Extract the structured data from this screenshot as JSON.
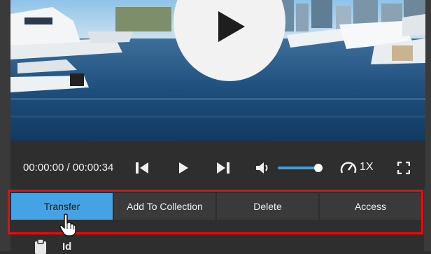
{
  "video": {
    "current_time": "00:00:00",
    "duration": "00:00:34",
    "time_display": "00:00:00 / 00:00:34",
    "playback_speed": "1X",
    "volume_fraction": 0.85
  },
  "actions": {
    "tabs": [
      {
        "label": "Transfer",
        "active": true
      },
      {
        "label": "Add To Collection",
        "active": false
      },
      {
        "label": "Delete",
        "active": false
      },
      {
        "label": "Access",
        "active": false
      }
    ]
  },
  "details": {
    "id_label": "Id"
  },
  "colors": {
    "accent": "#45a3e5",
    "highlight_border": "#e01010",
    "background": "#2e2e2e"
  },
  "icons": {
    "play_overlay": "play-icon",
    "skip_back": "skip-back-icon",
    "play": "play-icon",
    "skip_forward": "skip-forward-icon",
    "volume": "volume-icon",
    "speed": "speedometer-icon",
    "fullscreen": "fullscreen-icon",
    "clipboard": "clipboard-icon",
    "cursor": "hand-pointer-icon"
  }
}
